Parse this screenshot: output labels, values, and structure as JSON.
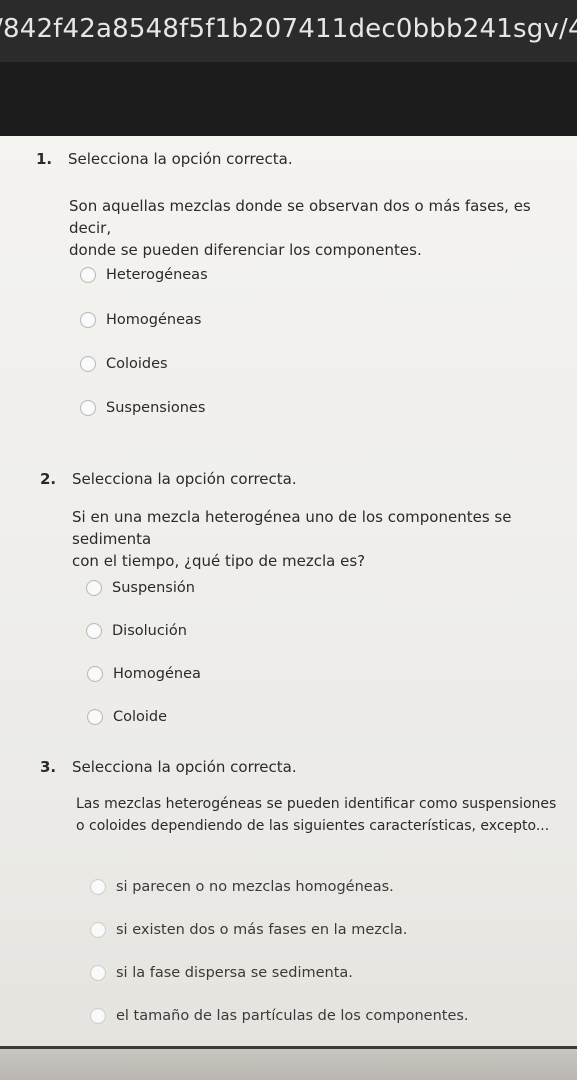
{
  "browser": {
    "url": "/842f42a8548f5f1b207411dec0bbb241sgv/4..."
  },
  "questions": [
    {
      "number": "1.",
      "title": "Selecciona la opción correcta.",
      "text_lines": [
        "Son aquellas mezclas donde se observan dos o más fases, es decir,",
        "donde se pueden diferenciar los componentes."
      ],
      "options": [
        "Heterogéneas",
        "Homogéneas",
        "Coloides",
        "Suspensiones"
      ]
    },
    {
      "number": "2.",
      "title": "Selecciona la opción correcta.",
      "text_lines": [
        "Si en una mezcla heterogénea uno de los componentes se sedimenta",
        "con el tiempo, ¿qué tipo de mezcla es?"
      ],
      "options": [
        "Suspensión",
        "Disolución",
        "Homogénea",
        "Coloide"
      ]
    },
    {
      "number": "3.",
      "title": "Selecciona la opción correcta.",
      "text_lines": [
        "Las mezclas heterogéneas se pueden identificar como suspensiones",
        "o coloides dependiendo de las siguientes características, excepto..."
      ],
      "options": [
        "si parecen o no mezclas homogéneas.",
        "si existen dos o más fases en la mezcla.",
        "si la fase dispersa se sedimenta.",
        "el tamaño de las partículas de los componentes."
      ]
    }
  ]
}
